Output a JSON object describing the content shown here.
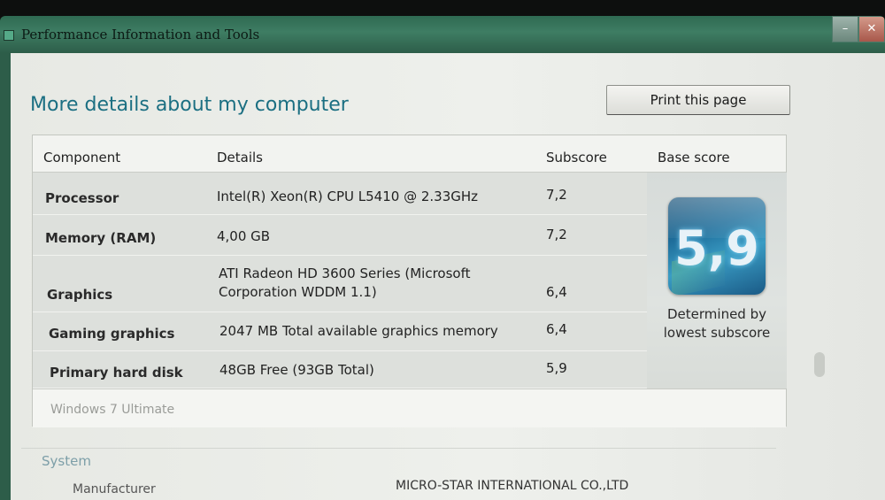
{
  "window": {
    "title": "Performance Information and Tools"
  },
  "heading": "More details about my computer",
  "print_button": "Print this page",
  "table": {
    "headers": {
      "component": "Component",
      "details": "Details",
      "subscore": "Subscore",
      "base": "Base score"
    },
    "rows": [
      {
        "component": "Processor",
        "details": "Intel(R) Xeon(R) CPU L5410 @ 2.33GHz",
        "subscore": "7,2"
      },
      {
        "component": "Memory (RAM)",
        "details": "4,00 GB",
        "subscore": "7,2"
      },
      {
        "component": "Graphics",
        "details": "ATI Radeon HD 3600 Series (Microsoft Corporation WDDM 1.1)",
        "subscore": "6,4"
      },
      {
        "component": "Gaming graphics",
        "details": "2047 MB Total available graphics memory",
        "subscore": "6,4"
      },
      {
        "component": "Primary hard disk",
        "details": "48GB Free (93GB Total)",
        "subscore": "5,9"
      }
    ],
    "base_score": "5,9",
    "base_note": "Determined by lowest subscore",
    "os": "Windows 7 Ultimate"
  },
  "system": {
    "label": "System",
    "manufacturer_label": "Manufacturer",
    "manufacturer_value": "MICRO-STAR INTERNATIONAL CO.,LTD"
  }
}
